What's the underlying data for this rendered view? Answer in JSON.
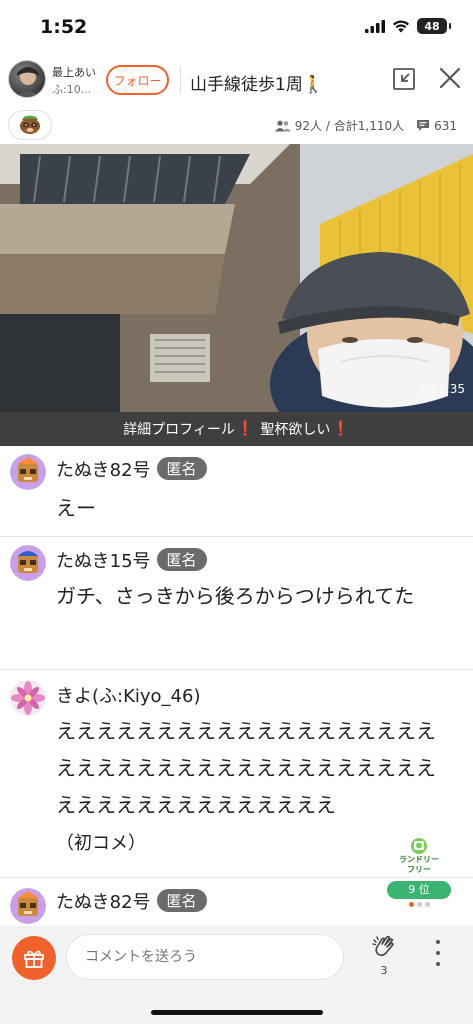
{
  "status_bar": {
    "time": "1:52",
    "battery": "48"
  },
  "header": {
    "host_name": "最上あい",
    "host_sub": "ふ:10...",
    "follow_label": "フォロー",
    "title": "山手線徒歩1周🚶"
  },
  "stats": {
    "viewers": "92人 / 合計1,110人",
    "comments": "631"
  },
  "video": {
    "elapsed": "1:21:35"
  },
  "info_bar": {
    "text_a": "詳細プロフィール",
    "text_b": "聖杯欲しい",
    "mark": "❗"
  },
  "comments": [
    {
      "name": "たぬき82号",
      "anon": "匿名",
      "text": "えー"
    },
    {
      "name": "たぬき15号",
      "anon": "匿名",
      "text": "ガチ、さっきから後ろからつけられてた"
    },
    {
      "name": "きよ(ふ:Kiyo_46)",
      "anon": "",
      "text": "ええええええええええええええええええええええええええええええええええええええええええええええええええええ",
      "note": "（初コメ）"
    },
    {
      "name": "たぬき82号",
      "anon": "匿名",
      "text": ""
    }
  ],
  "rank": {
    "label_top": "ランドリー",
    "label_bottom": "フリー",
    "position": "9 位"
  },
  "bottom": {
    "input_placeholder": "コメントを送ろう",
    "clap_count": "3"
  },
  "colors": {
    "accent": "#f0612c",
    "rank_green": "#3cb371",
    "anon_gray": "#6b6b6b"
  }
}
